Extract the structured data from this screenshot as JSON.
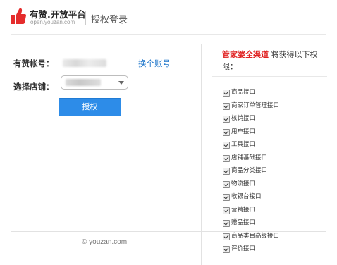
{
  "header": {
    "logo_title": "有赞.开放平台",
    "logo_subtitle": "open.youzan.com",
    "page_title": "授权登录",
    "logo_color": "#e52c2c"
  },
  "form": {
    "account_label": "有赞帐号：",
    "switch_account_label": "换个账号",
    "store_label": "选择店铺：",
    "authorize_button_label": "授权",
    "button_color": "#2d8ce8",
    "link_color": "#1a73c9"
  },
  "permissions": {
    "app_name": "管家婆全渠道",
    "intro_text": " 将获得以下权限：",
    "app_name_color": "#e02020",
    "items": [
      {
        "label": "商品接口",
        "checked": true
      },
      {
        "label": "商家订单管理接口",
        "checked": true
      },
      {
        "label": "核销接口",
        "checked": true
      },
      {
        "label": "用户接口",
        "checked": true
      },
      {
        "label": "工具接口",
        "checked": true
      },
      {
        "label": "店铺基础接口",
        "checked": true
      },
      {
        "label": "商品分类接口",
        "checked": true
      },
      {
        "label": "物流接口",
        "checked": true
      },
      {
        "label": "收银台接口",
        "checked": true
      },
      {
        "label": "营销接口",
        "checked": true
      },
      {
        "label": "赠品接口",
        "checked": true
      },
      {
        "label": "商品类目高级接口",
        "checked": true
      },
      {
        "label": "评价接口",
        "checked": true
      }
    ]
  },
  "footer": {
    "copyright": "© youzan.com"
  }
}
